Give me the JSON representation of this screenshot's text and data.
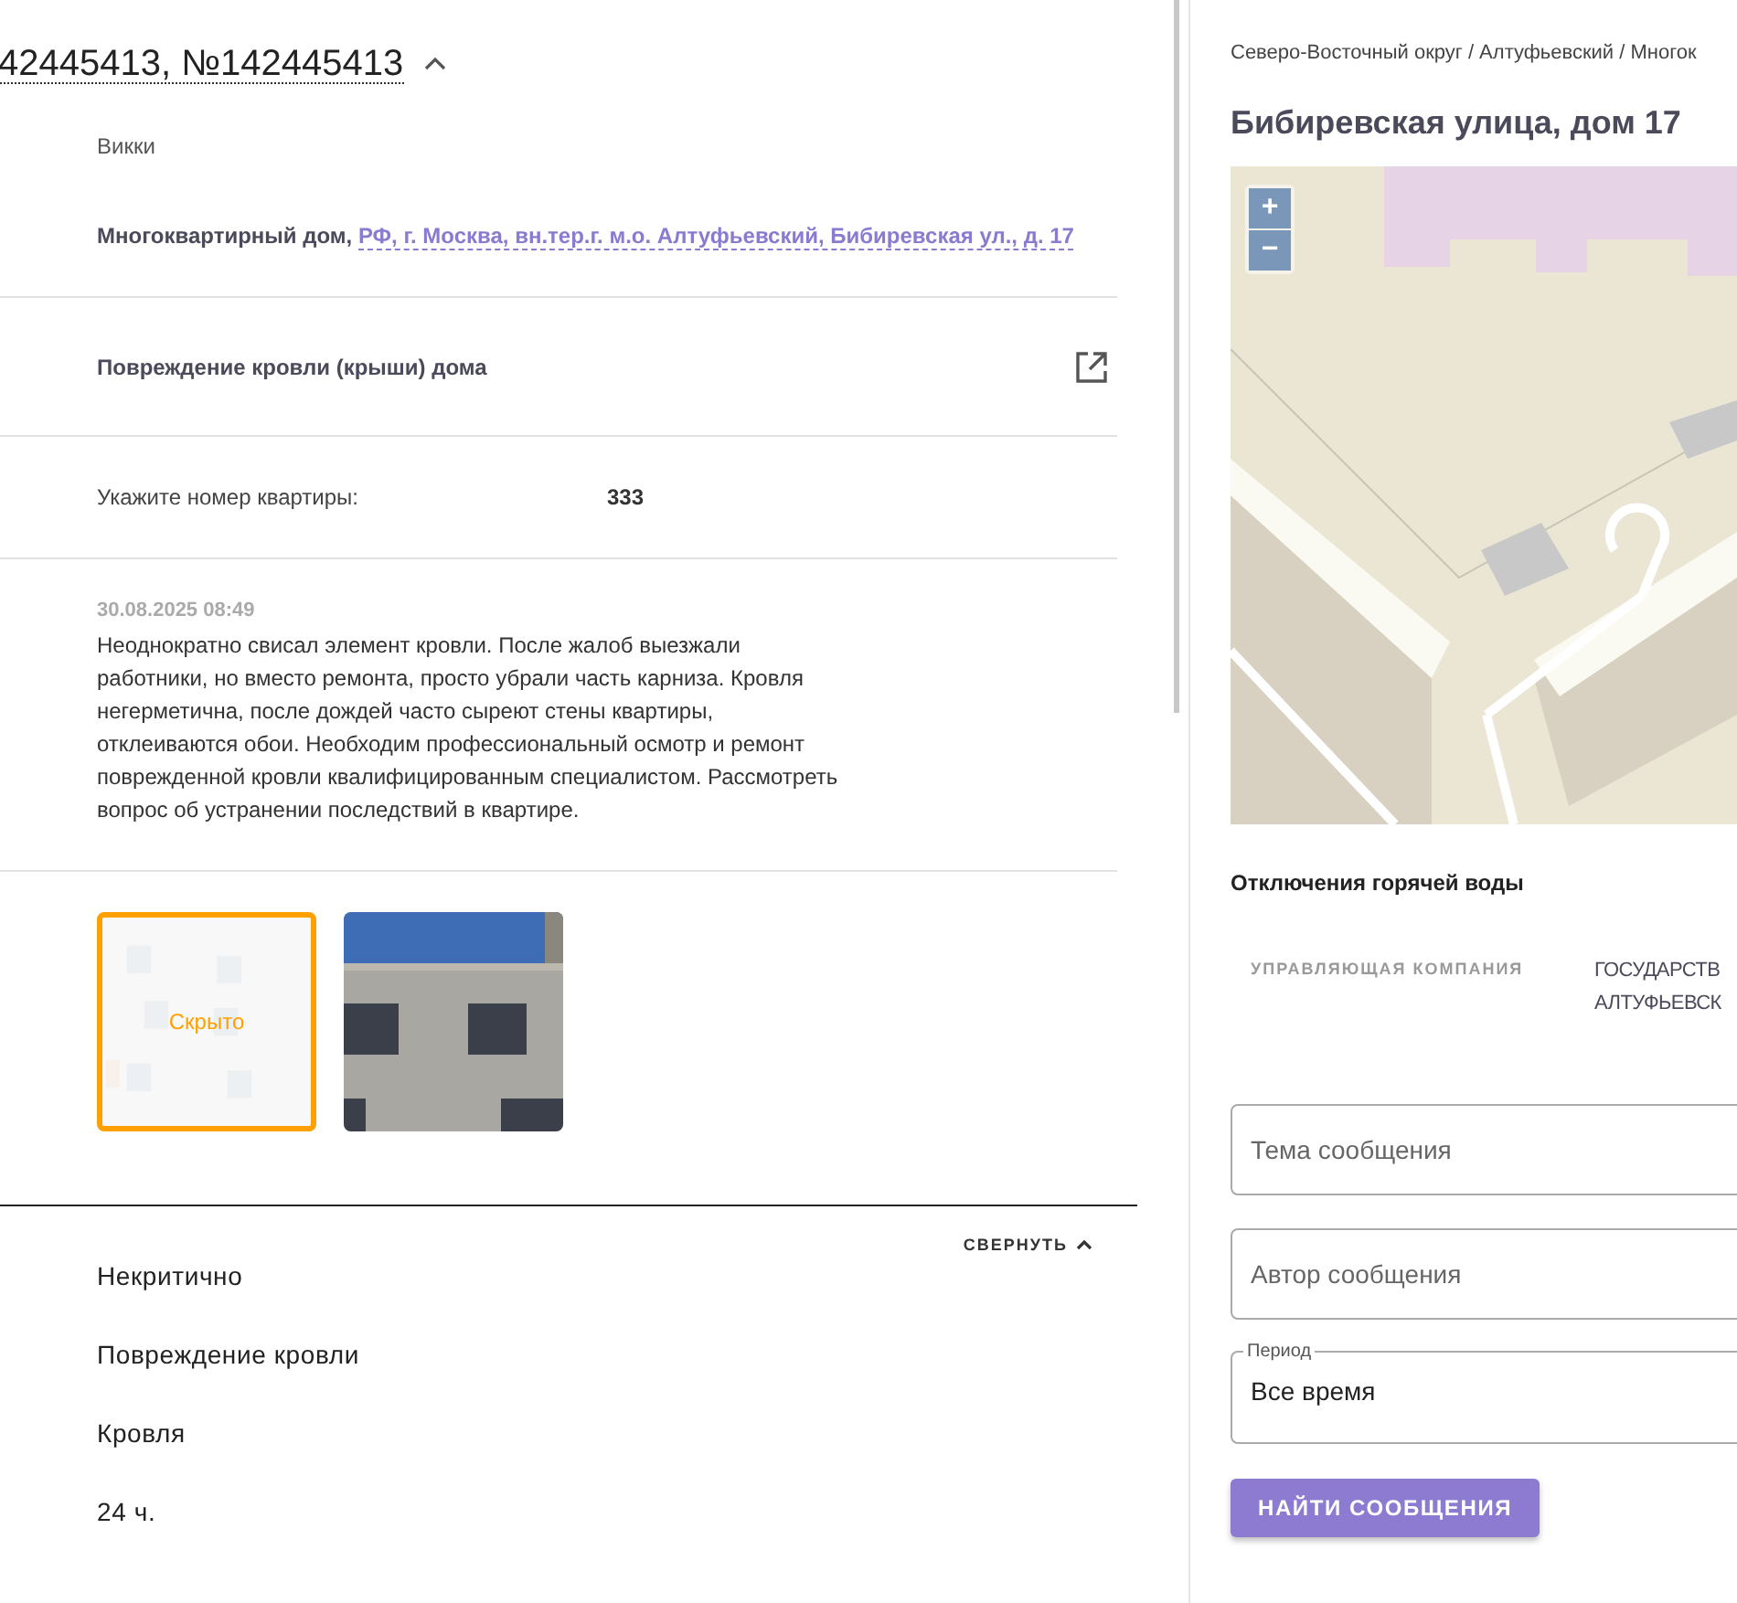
{
  "request": {
    "title": "42445413, №142445413",
    "expanded": true,
    "author": "Викки",
    "address_prefix": "Многоквартирный дом,",
    "address_link": "РФ, г. Москва, вн.тер.г. м.о. Алтуфьевский, Бибиревская ул., д. 17",
    "category": "Повреждение кровли (крыши) дома",
    "flat_label": "Укажите номер квартиры:",
    "flat_value": "333",
    "date": "30.08.2025 08:49",
    "message": "Неоднократно свисал элемент кровли. После жалоб выезжали работники, но вместо ремонта, просто убрали часть карниза. Кровля негерметична, после дождей часто сыреют стены квартиры, отклеиваются обои. Необходим профессиональный осмотр и ремонт поврежденной кровли квалифицированным специалистом. Рассмотреть вопрос об устранении последствий в квартире.",
    "photos": [
      {
        "kind": "picture",
        "hidden": true,
        "overlay": "Скрыто"
      },
      {
        "kind": "picture",
        "hidden": false
      }
    ]
  },
  "details": {
    "collapse_label": "СВЕРНУТЬ",
    "expanded": true,
    "items": [
      "Некритично",
      "Повреждение кровли",
      "Кровля",
      "24 ч."
    ]
  },
  "house": {
    "breadcrumb": "Северо-Восточный округ / Алтуфьевский / Многок",
    "title": "Бибиревская улица, дом 17",
    "map": {
      "kind": "picture",
      "zoom_in": "+",
      "zoom_out": "−"
    },
    "notice": "Отключения горячей воды",
    "company_label": "УПРАВЛЯЮЩАЯ КОМПАНИЯ",
    "company_value": [
      "ГОСУДАРСТВ",
      "АЛТУФЬЕВСК"
    ]
  },
  "search": {
    "fields": [
      {
        "kind": "text",
        "placeholder": "Тема сообщения"
      },
      {
        "kind": "text",
        "placeholder": "Автор сообщения"
      },
      {
        "kind": "select",
        "label": "Период",
        "value": "Все время"
      }
    ],
    "button": "НАЙТИ СООБЩЕНИЯ"
  }
}
